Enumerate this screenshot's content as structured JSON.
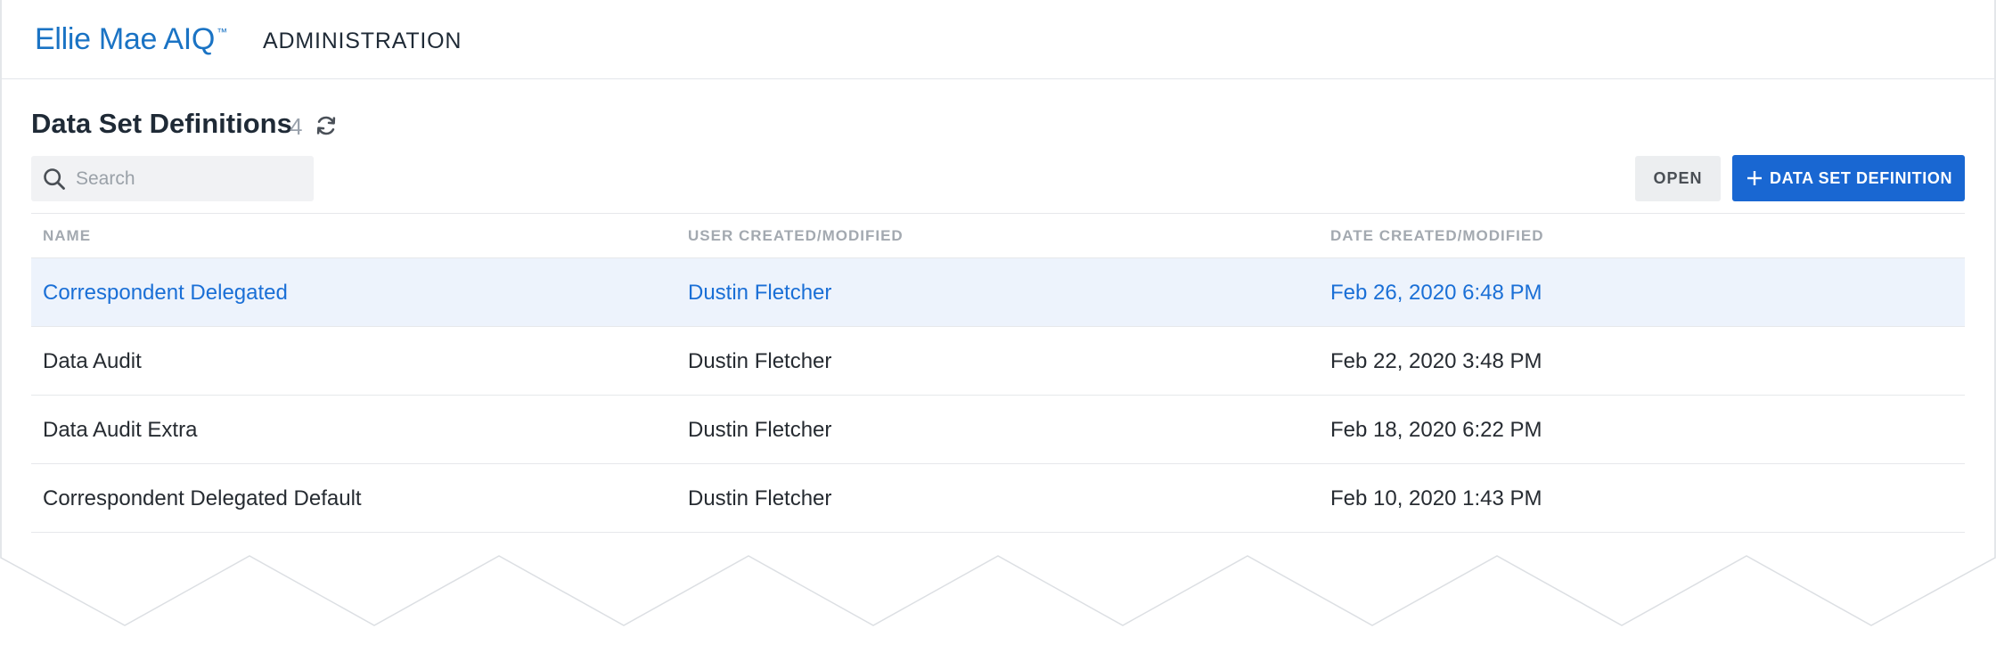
{
  "header": {
    "logo_text": "Ellie Mae AIQ",
    "logo_tm": "™",
    "app_title": "ADMINISTRATION"
  },
  "page": {
    "title": "Data Set Definitions",
    "count": "4"
  },
  "icons": {
    "refresh": "refresh-icon",
    "search": "search-icon",
    "plus": "plus-icon"
  },
  "search": {
    "placeholder": "Search",
    "value": ""
  },
  "toolbar": {
    "open_label": "OPEN",
    "add_label": "DATA SET DEFINITION"
  },
  "table": {
    "columns": [
      "NAME",
      "USER CREATED/MODIFIED",
      "DATE CREATED/MODIFIED"
    ],
    "rows": [
      {
        "name": "Correspondent Delegated",
        "user": "Dustin Fletcher",
        "date": "Feb 26, 2020 6:48 PM",
        "selected": true
      },
      {
        "name": "Data Audit",
        "user": "Dustin Fletcher",
        "date": "Feb 22, 2020 3:48 PM",
        "selected": false
      },
      {
        "name": "Data Audit Extra",
        "user": "Dustin Fletcher",
        "date": "Feb 18, 2020 6:22 PM",
        "selected": false
      },
      {
        "name": "Correspondent Delegated Default",
        "user": "Dustin Fletcher",
        "date": "Feb 10, 2020 1:43 PM",
        "selected": false
      }
    ]
  },
  "colors": {
    "brand": "#1a73c4",
    "primary_button": "#1967d2",
    "selected_row_bg": "#edf3fc",
    "selected_text": "#1a6fd6"
  }
}
